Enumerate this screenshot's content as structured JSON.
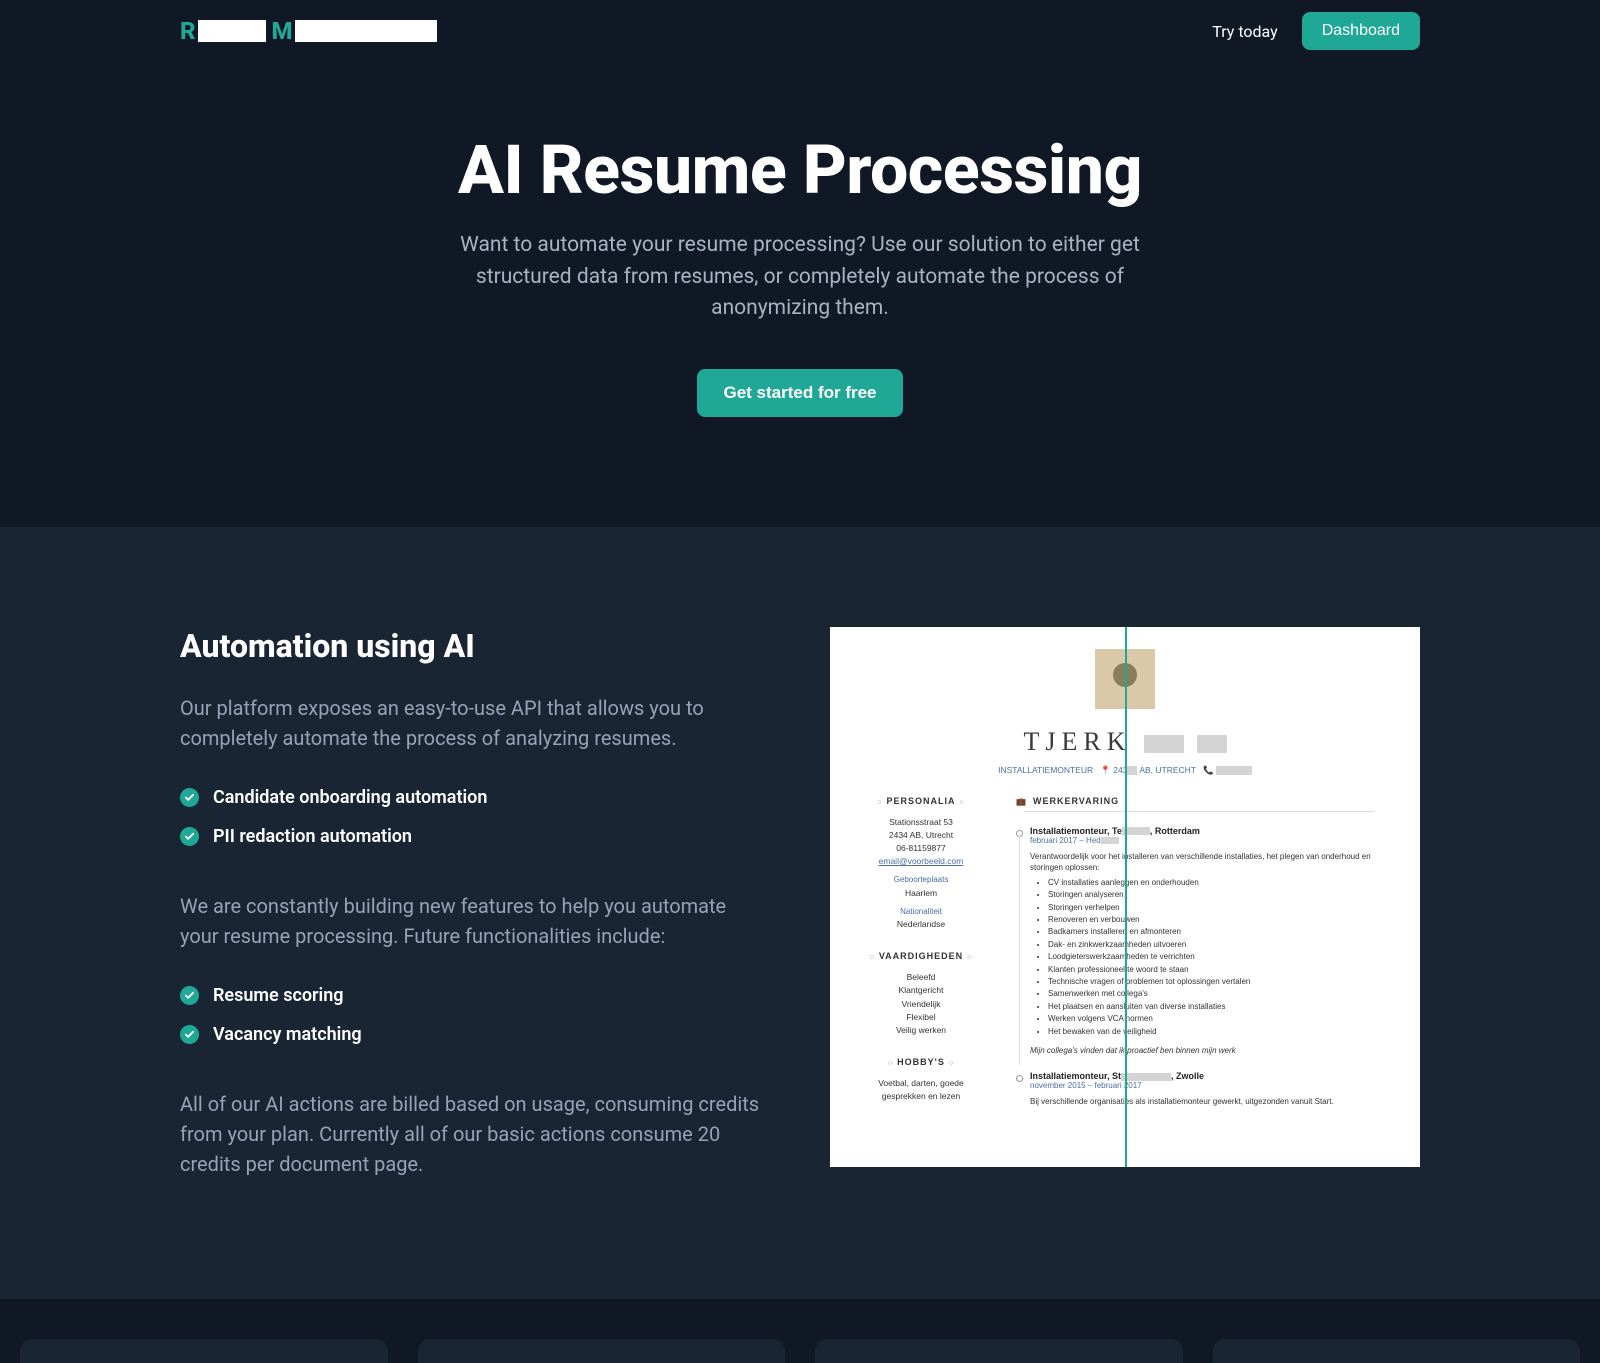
{
  "nav": {
    "try_label": "Try today",
    "dashboard_label": "Dashboard"
  },
  "hero": {
    "title": "AI Resume Processing",
    "subtitle": "Want to automate your resume processing? Use our solution to either get structured data from resumes, or completely automate the process of anonymizing them.",
    "cta": "Get started for free"
  },
  "automation": {
    "heading": "Automation using AI",
    "para1": "Our platform exposes an easy-to-use API that allows you to completely automate the process of analyzing resumes.",
    "features_current": [
      "Candidate onboarding automation",
      "PII redaction automation"
    ],
    "para2": "We are constantly building new features to help you automate your resume processing. Future functionalities include:",
    "features_future": [
      "Resume scoring",
      "Vacancy matching"
    ],
    "para3": "All of our AI actions are billed based on usage, consuming credits from your plan. Currently all of our basic actions consume 20 credits per document page."
  },
  "resume": {
    "name": "TJERK",
    "role": "INSTALLATIEMONTEUR",
    "address_part": "243",
    "city": "AB, UTRECHT",
    "sections": {
      "personalia": "PERSONALIA",
      "vaardigheden": "VAARDIGHEDEN",
      "hobbys": "HOBBY'S",
      "werkervaring": "WERKERVARING"
    },
    "personalia": {
      "street": "Stationsstraat 53",
      "postal": "2434 AB, Utrecht",
      "phone": "06-81159877",
      "email": "email@voorbeeld.com",
      "birthplace_label": "Geboorteplaats",
      "birthplace": "Haarlem",
      "nationality_label": "Nationaliteit",
      "nationality": "Nederlandse"
    },
    "skills": [
      "Beleefd",
      "Klantgericht",
      "Vriendelijk",
      "Flexibel",
      "Veilig werken"
    ],
    "hobbies": "Voetbal, darten, goede gesprekken en lezen",
    "job1": {
      "title_prefix": "Installatiemonteur, Te",
      "title_suffix": ", Rotterdam",
      "date_prefix": "februari 2017 – Hed",
      "desc": "Verantwoordelijk voor het installeren van verschillende installaties, het plegen van onderhoud en storingen oplossen:",
      "bullets": [
        "CV installaties aanleggen en onderhouden",
        "Storingen analyseren",
        "Storingen verhelpen",
        "Renoveren en verbouwen",
        "Badkamers installeren en afmonteren",
        "Dak- en zinkwerkzaamheden uitvoeren",
        "Loodgieterswerkzaamheden te verrichten",
        "Klanten professioneel te woord te staan",
        "Technische vragen of problemen tot oplossingen vertalen",
        "Samenwerken met collega's",
        "Het plaatsen en aansluiten van diverse installaties",
        "Werken volgens VCA normen",
        "Het bewaken van de veiligheid"
      ],
      "quote": "Mijn collega's vinden dat ik proactief ben binnen mijn werk"
    },
    "job2": {
      "title_prefix": "Installatiemonteur, St",
      "title_suffix": ", Zwolle",
      "date": "november 2015 – februari 2017",
      "desc": "Bij verschillende organisaties als installatiemonteur gewerkt, uitgezonden vanuit Start."
    }
  }
}
